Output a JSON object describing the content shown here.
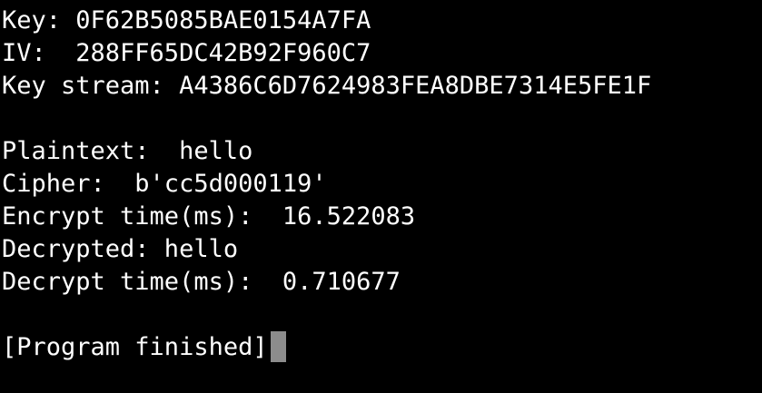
{
  "terminal": {
    "lines": [
      "Key: 0F62B5085BAE0154A7FA",
      "IV:  288FF65DC42B92F960C7",
      "Key stream: A4386C6D7624983FEA8DBE7314E5FE1F",
      "",
      "Plaintext:  hello",
      "Cipher:  b'cc5d000119'",
      "Encrypt time(ms):  16.522083",
      "Decrypted: hello",
      "Decrypt time(ms):  0.710677",
      "",
      "[Program finished]"
    ],
    "colors": {
      "background": "#000000",
      "text": "#ffffff",
      "cursor": "#8c8c8c"
    }
  }
}
